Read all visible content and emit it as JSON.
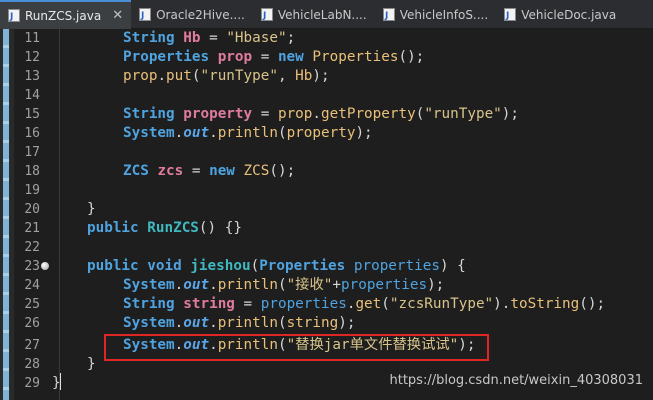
{
  "tabs": [
    {
      "label": "RunZCS.java",
      "active": true,
      "closable": true
    },
    {
      "label": "Oracle2Hive....",
      "active": false
    },
    {
      "label": "VehicleLabN....",
      "active": false
    },
    {
      "label": "VehicleInfoS....",
      "active": false
    },
    {
      "label": "VehicleDoc.java",
      "active": false
    }
  ],
  "line_numbers": [
    "11",
    "12",
    "13",
    "14",
    "15",
    "16",
    "17",
    "18",
    "19",
    "20",
    "21",
    "22",
    "23",
    "24",
    "25",
    "26",
    "27",
    "28",
    "29"
  ],
  "code_lines": {
    "l11": [
      "String",
      " ",
      "Hb",
      " = ",
      "\"Hbase\"",
      ";"
    ],
    "l12": [
      "Properties",
      " ",
      "prop",
      " = ",
      "new",
      " ",
      "Properties",
      "();"
    ],
    "l13": [
      "prop",
      ".",
      "put",
      "(",
      "\"runType\"",
      ", ",
      "Hb",
      ");"
    ],
    "l15": [
      "String",
      " ",
      "property",
      " = ",
      "prop",
      ".",
      "getProperty",
      "(",
      "\"runType\"",
      ");"
    ],
    "l16": [
      "System",
      ".",
      "out",
      ".",
      "println",
      "(",
      "property",
      ");"
    ],
    "l18": [
      "ZCS",
      " ",
      "zcs",
      " = ",
      "new",
      " ",
      "ZCS",
      "();"
    ],
    "l20": [
      "}"
    ],
    "l21": [
      "public",
      " ",
      "RunZCS",
      "() {}"
    ],
    "l23": [
      "public",
      " ",
      "void",
      " ",
      "jieshou",
      "(",
      "Properties",
      " ",
      "properties",
      ") {"
    ],
    "l24": [
      "System",
      ".",
      "out",
      ".",
      "println",
      "(",
      "\"接收\"",
      "+",
      "properties",
      ");"
    ],
    "l25": [
      "String",
      " ",
      "string",
      " = ",
      "properties",
      ".",
      "get",
      "(",
      "\"zcsRunType\"",
      ").",
      "toString",
      "();"
    ],
    "l26": [
      "System",
      ".",
      "out",
      ".",
      "println",
      "(",
      "string",
      ");"
    ],
    "l27": [
      "System",
      ".",
      "out",
      ".",
      "println",
      "(",
      "\"替换jar单文件替换试试\"",
      ");"
    ],
    "l28": [
      "}"
    ],
    "l29": [
      "}"
    ]
  },
  "watermark": "https://blog.csdn.net/weixin_40308031",
  "colors": {
    "highlight_box": "#e02525",
    "keyword": "#4fa3e0",
    "string": "#d8c38a",
    "variable": "#e07ba0"
  }
}
